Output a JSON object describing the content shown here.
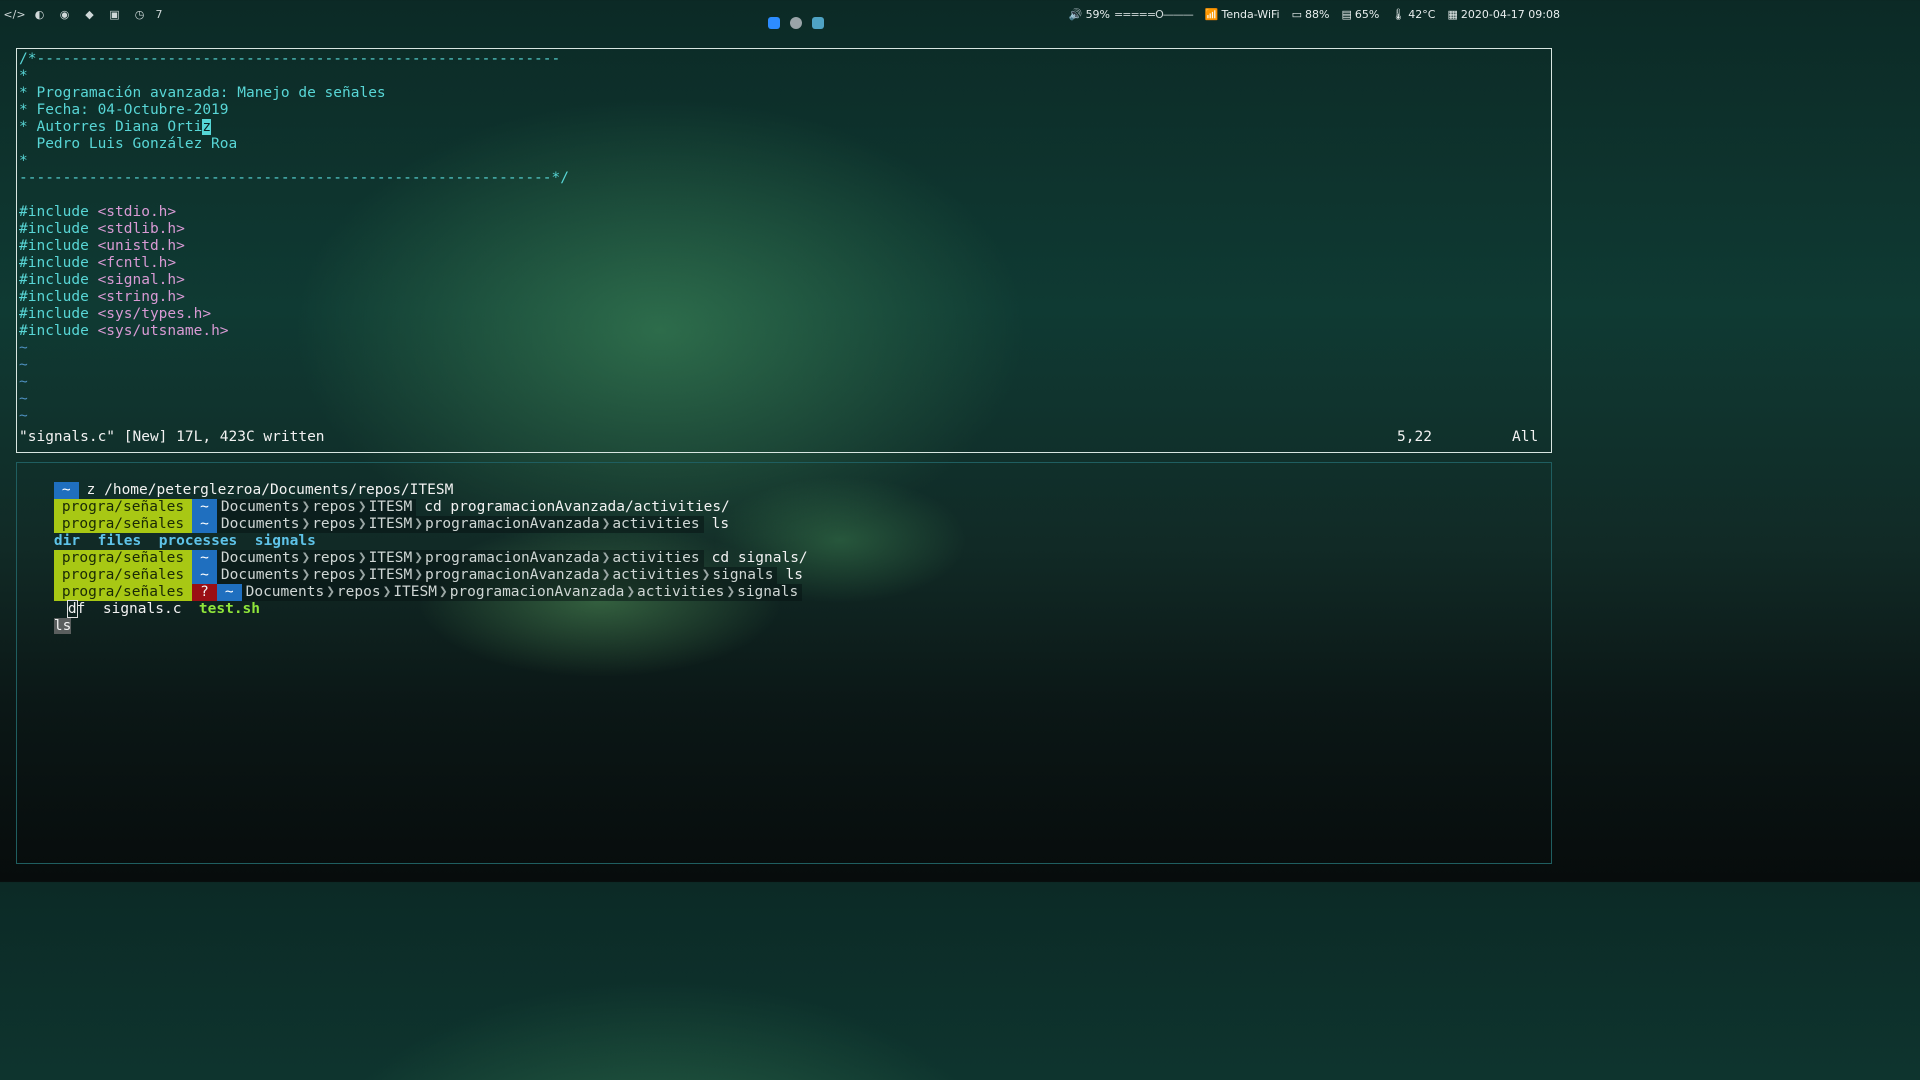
{
  "topbar": {
    "workspaces": [
      {
        "icon": "code-icon",
        "glyph": "</>"
      },
      {
        "icon": "globe-icon",
        "glyph": "◐"
      },
      {
        "icon": "spotify-icon",
        "glyph": "◉"
      },
      {
        "icon": "git-icon",
        "glyph": "◆"
      },
      {
        "icon": "book-icon",
        "glyph": "▣"
      },
      {
        "icon": "clock-icon",
        "glyph": "◷"
      }
    ],
    "workspace_number": "7",
    "tray": [
      {
        "icon": "zoom-icon",
        "color": "#2d8cff"
      },
      {
        "icon": "settings-icon",
        "color": "#9aa4a8"
      },
      {
        "icon": "image-icon",
        "color": "#4fa3c4"
      }
    ],
    "volume": "59%",
    "volume_bar": "=====O———",
    "wifi": "Tenda-WiFi",
    "battery": "88%",
    "ram": "65%",
    "temp": "42°C",
    "date": "2020-04-17 09:08"
  },
  "vim": {
    "lines": [
      {
        "text": "/*------------------------------------------------------------",
        "cls": "cyan"
      },
      {
        "text": "*",
        "cls": "cyan"
      },
      {
        "text": "* Programación avanzada: Manejo de señales",
        "cls": "cyan"
      },
      {
        "text": "* Fecha: 04-Octubre-2019",
        "cls": "cyan"
      },
      {
        "text": "* Autorres Diana Orti",
        "cls": "cyan",
        "cursor": "z"
      },
      {
        "text": "  Pedro Luis González Roa",
        "cls": "cyan"
      },
      {
        "text": "*",
        "cls": "cyan"
      },
      {
        "text": "-------------------------------------------------------------*/",
        "cls": "cyan"
      },
      {
        "text": "",
        "cls": "cyan"
      },
      {
        "text": "#include",
        "cls": "cyan",
        "header": "<stdio.h>"
      },
      {
        "text": "#include",
        "cls": "cyan",
        "header": "<stdlib.h>"
      },
      {
        "text": "#include",
        "cls": "cyan",
        "header": "<unistd.h>"
      },
      {
        "text": "#include",
        "cls": "cyan",
        "header": "<fcntl.h>"
      },
      {
        "text": "#include",
        "cls": "cyan",
        "header": "<signal.h>"
      },
      {
        "text": "#include",
        "cls": "cyan",
        "header": "<string.h>"
      },
      {
        "text": "#include",
        "cls": "cyan",
        "header": "<sys/types.h>"
      },
      {
        "text": "#include",
        "cls": "cyan",
        "header": "<sys/utsname.h>"
      },
      {
        "text": "~",
        "cls": "tilde"
      },
      {
        "text": "~",
        "cls": "tilde"
      },
      {
        "text": "~",
        "cls": "tilde"
      },
      {
        "text": "~",
        "cls": "tilde"
      },
      {
        "text": "~",
        "cls": "tilde"
      }
    ],
    "status_msg": "\"signals.c\" [New] 17L, 423C written",
    "position": "5,22",
    "scroll": "All"
  },
  "terminal": {
    "z_home": "~",
    "z_cmd": "z /home/peterglezroa/Documents/repos/ITESM",
    "branch": "progra/señales",
    "home": "~",
    "question": "?",
    "path1": [
      "Documents",
      "repos",
      "ITESM"
    ],
    "path2": [
      "Documents",
      "repos",
      "ITESM",
      "programacionAvanzada",
      "activities"
    ],
    "path3": [
      "Documents",
      "repos",
      "ITESM",
      "programacionAvanzada",
      "activities",
      "signals"
    ],
    "cmd1": "cd programacionAvanzada/activities/",
    "cmd2": "ls",
    "ls1": [
      "dir",
      "files",
      "processes",
      "signals"
    ],
    "cmd3": "cd signals/",
    "cmd4": "ls",
    "ls2_cursor": "d",
    "ls2_rest": "f",
    "ls2_file": "signals.c",
    "ls2_exec": "test.sh",
    "hist_cmd": "ls"
  }
}
